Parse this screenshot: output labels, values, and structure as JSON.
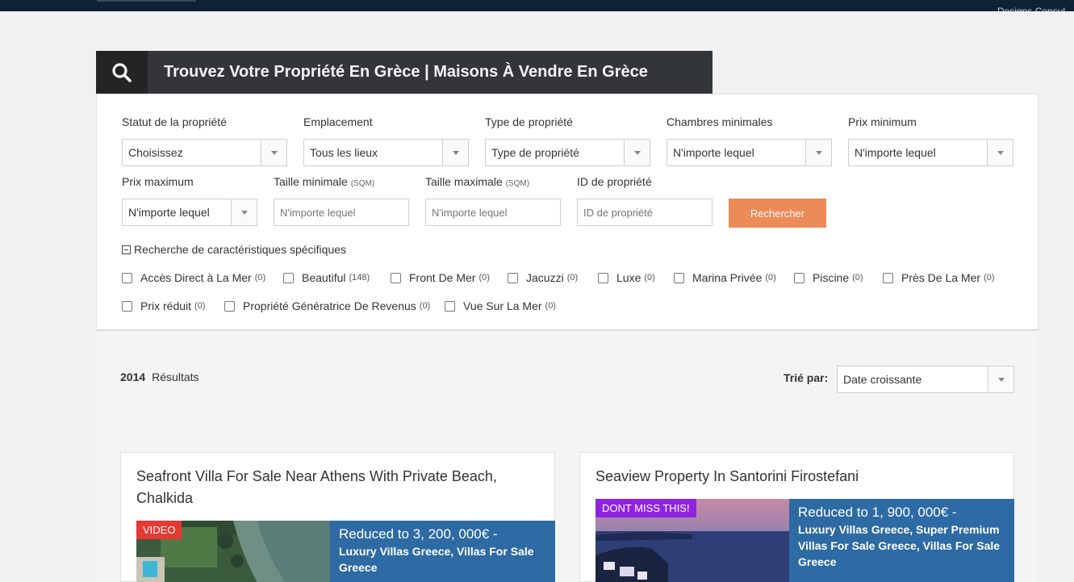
{
  "topbar": {
    "right_text": "Designs Consul"
  },
  "header": {
    "title": "Trouvez Votre Propriété En Grèce | Maisons À Vendre En Grèce"
  },
  "search": {
    "status": {
      "label": "Statut de la propriété",
      "value": "Choisissez"
    },
    "location": {
      "label": "Emplacement",
      "value": "Tous les lieux"
    },
    "type": {
      "label": "Type de propriété",
      "value": "Type de propriété"
    },
    "bedrooms": {
      "label": "Chambres minimales",
      "value": "N'importe lequel"
    },
    "min_price": {
      "label": "Prix minimum",
      "value": "N'importe lequel"
    },
    "max_price": {
      "label": "Prix maximum",
      "value": "N'importe lequel"
    },
    "min_size": {
      "label": "Taille minimale",
      "unit": "(SQM)",
      "placeholder": "N'importe lequel"
    },
    "max_size": {
      "label": "Taille maximale",
      "unit": "(SQM)",
      "placeholder": "N'importe lequel"
    },
    "property_id": {
      "label": "ID de propriété",
      "placeholder": "ID de propriété"
    },
    "button": "Rechercher",
    "features_toggle": "Recherche de caractéristiques spécifiques",
    "features": [
      {
        "label": "Accès Direct à La Mer",
        "count": "(0)"
      },
      {
        "label": "Beautiful",
        "count": "(148)"
      },
      {
        "label": "Front De Mer",
        "count": "(0)"
      },
      {
        "label": "Jacuzzi",
        "count": "(0)"
      },
      {
        "label": "Luxe",
        "count": "(0)"
      },
      {
        "label": "Marina Privée",
        "count": "(0)"
      },
      {
        "label": "Piscine",
        "count": "(0)"
      },
      {
        "label": "Près De La Mer",
        "count": "(0)"
      },
      {
        "label": "Prix réduit",
        "count": "(0)"
      },
      {
        "label": "Propriété Génératrice De Revenus",
        "count": "(0)"
      },
      {
        "label": "Vue Sur La Mer",
        "count": "(0)"
      }
    ]
  },
  "results": {
    "count": "2014",
    "count_label": "Résultats",
    "sort_label": "Trié par:",
    "sort_value": "Date croissante"
  },
  "listings": [
    {
      "title": "Seafront Villa For Sale Near Athens With Private Beach, Chalkida",
      "badge": "VIDEO",
      "badge_color": "#e53935",
      "price": "Reduced to 3, 200, 000€ -",
      "tags": "Luxury Villas Greece, Villas For Sale Greece"
    },
    {
      "title": "Seaview Property In Santorini Firostefani",
      "badge": "DONT MISS THIS!",
      "badge_color": "#8e24e0",
      "price": "Reduced to 1, 900, 000€ -",
      "tags": "Luxury Villas Greece, Super Premium Villas For Sale Greece, Villas For Sale Greece"
    }
  ],
  "colors": {
    "accent_button": "#ec8a58",
    "price_box": "#2e6aa3",
    "header_bg": "#333639"
  }
}
